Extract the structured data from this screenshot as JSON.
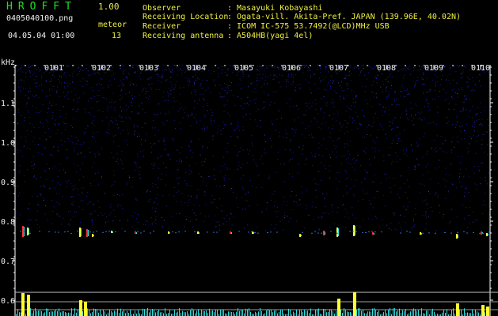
{
  "header": {
    "app_title": "HROFFT",
    "app_version": "1.00",
    "filename": "0405040100.png",
    "datetime": "04.05.04 01:00",
    "meteor_label": "meteor",
    "meteor_count": "13",
    "rows": [
      {
        "label": "Observer",
        "value": ": Masayuki Kobayashi"
      },
      {
        "label": "Receiving Location",
        "value": ": Ogata-vill. Akita-Pref. JAPAN (139.96E, 40.02N)"
      },
      {
        "label": "Receiver",
        "value": ": ICOM IC-575 53.7492(@LCD)MHz USB"
      },
      {
        "label": "Receiving antenna",
        "value": ": A504HB(yagi 4el)"
      }
    ]
  },
  "spectrogram": {
    "y_unit": "kHz",
    "y_ticks": [
      "1.1",
      "1.0",
      "0.9",
      "0.8",
      "0.7",
      "0.6"
    ],
    "x_ticks": [
      "0101",
      "0102",
      "0103",
      "0104",
      "0105",
      "0106",
      "0107",
      "0108",
      "0109",
      "0110"
    ]
  },
  "colors": {
    "background": "#000000",
    "noise": "#1a1aa0",
    "tick": "#ffffff",
    "title": "#22e022",
    "text": "#f0f040",
    "meteor_red": "#ff3030",
    "meteor_yellow": "#ffff30",
    "trace_cyan": "#30e0e0"
  }
}
